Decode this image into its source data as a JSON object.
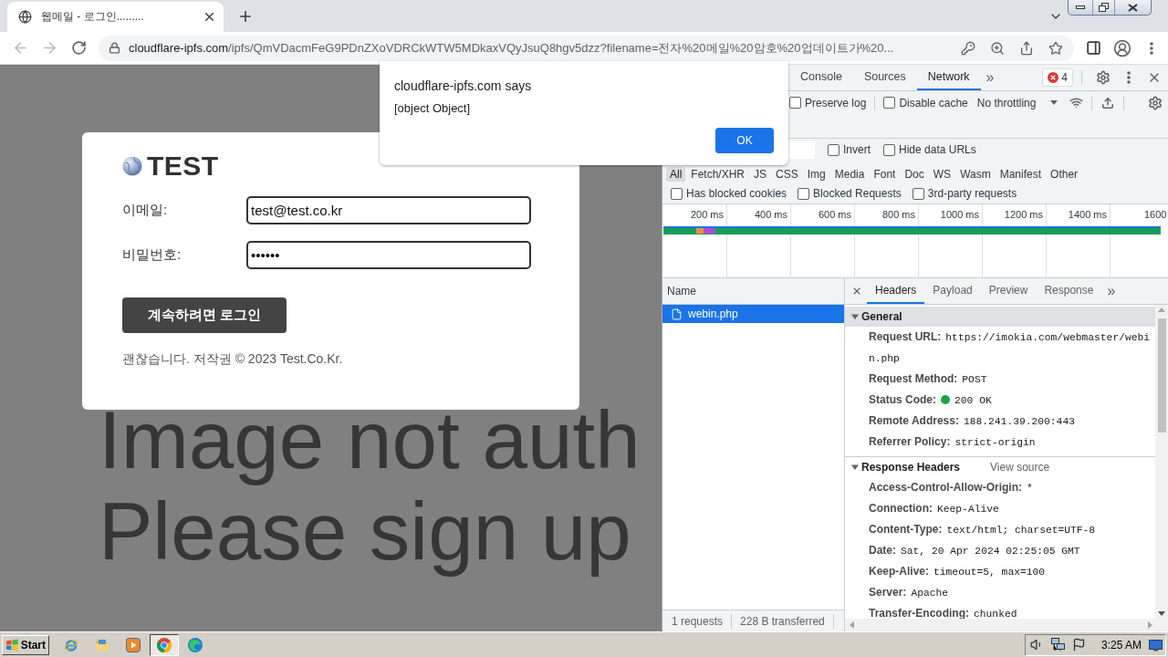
{
  "browser": {
    "tabs": [
      {
        "title": "웹메일 - 로그인.........",
        "selected": true
      }
    ],
    "address": {
      "host": "cloudflare-ipfs.com",
      "path": "/ipfs/QmVDacmFeG9PDnZXoVDRCkWTW5MDkaxVQyJsuQ8hgv5dzz?filename=전자%20메일%20암호%20업데이트가%20..."
    }
  },
  "page": {
    "logo": "TEST",
    "fields": [
      {
        "label": "이메일:",
        "value": "test@test.co.kr"
      },
      {
        "label": "비밀번호:",
        "value": "••••••"
      }
    ],
    "button": "계속하려면 로그인",
    "footer": "괜찮습니다. 저작권 © 2023 Test.Co.Kr.",
    "background_text": [
      "Image not auth",
      "Please sign up"
    ]
  },
  "dialog": {
    "title": "cloudflare-ipfs.com says",
    "message": "[object Object]",
    "button": "OK"
  },
  "devtools": {
    "tabs": [
      {
        "label": "Console",
        "selected": false
      },
      {
        "label": "Sources",
        "selected": false
      },
      {
        "label": "Network",
        "selected": true
      }
    ],
    "more_tabs": "»",
    "error_count": "4",
    "toolbar_checks": [
      {
        "label": "Preserve log",
        "checked": false
      },
      {
        "label": "Disable cache",
        "checked": false
      }
    ],
    "throttling": "No throttling",
    "filter_checks": [
      {
        "label": "Invert",
        "checked": false
      },
      {
        "label": "Hide data URLs",
        "checked": false
      }
    ],
    "type_filters": [
      {
        "label": "All",
        "selected": true
      },
      {
        "label": "Fetch/XHR",
        "selected": false
      },
      {
        "label": "JS",
        "selected": false
      },
      {
        "label": "CSS",
        "selected": false
      },
      {
        "label": "Img",
        "selected": false
      },
      {
        "label": "Media",
        "selected": false
      },
      {
        "label": "Font",
        "selected": false
      },
      {
        "label": "Doc",
        "selected": false
      },
      {
        "label": "WS",
        "selected": false
      },
      {
        "label": "Wasm",
        "selected": false
      },
      {
        "label": "Manifest",
        "selected": false
      },
      {
        "label": "Other",
        "selected": false
      }
    ],
    "request_checks": [
      {
        "label": "Has blocked cookies",
        "checked": false
      },
      {
        "label": "Blocked Requests",
        "checked": false
      },
      {
        "label": "3rd-party requests",
        "checked": false
      }
    ],
    "overview_ticks": [
      "200 ms",
      "400 ms",
      "600 ms",
      "800 ms",
      "1000 ms",
      "1200 ms",
      "1400 ms",
      "1600"
    ],
    "requests": {
      "column": "Name",
      "rows": [
        {
          "name": "webin.php",
          "selected": true
        }
      ]
    },
    "summary": [
      "1 requests",
      "228 B transferred"
    ],
    "detail_tabs": [
      {
        "label": "Headers",
        "selected": true
      },
      {
        "label": "Payload",
        "selected": false
      },
      {
        "label": "Preview",
        "selected": false
      },
      {
        "label": "Response",
        "selected": false
      }
    ],
    "more_detail_tabs": "»",
    "sections": [
      {
        "title": "General",
        "expanded": true,
        "highlighted": true,
        "rows": [
          {
            "name": "Request URL:",
            "value": "https://imokia.com/webmaster/webin.php",
            "kind": "plain"
          },
          {
            "name": "Request Method:",
            "value": "POST",
            "kind": "plain"
          },
          {
            "name": "Status Code:",
            "value": "200 OK",
            "kind": "status"
          },
          {
            "name": "Remote Address:",
            "value": "188.241.39.200:443",
            "kind": "plain"
          },
          {
            "name": "Referrer Policy:",
            "value": "strict-origin",
            "kind": "plain"
          }
        ]
      },
      {
        "title": "Response Headers",
        "expanded": true,
        "highlighted": false,
        "link": "View source",
        "rows": [
          {
            "name": "Access-Control-Allow-Origin:",
            "value": "*",
            "kind": "plain"
          },
          {
            "name": "Connection:",
            "value": "Keep-Alive",
            "kind": "plain"
          },
          {
            "name": "Content-Type:",
            "value": "text/html; charset=UTF-8",
            "kind": "plain"
          },
          {
            "name": "Date:",
            "value": "Sat, 20 Apr 2024 02:25:05 GMT",
            "kind": "plain"
          },
          {
            "name": "Keep-Alive:",
            "value": "timeout=5, max=100",
            "kind": "plain"
          },
          {
            "name": "Server:",
            "value": "Apache",
            "kind": "plain"
          },
          {
            "name": "Transfer-Encoding:",
            "value": "chunked",
            "kind": "plain"
          }
        ]
      }
    ]
  },
  "taskbar": {
    "start": "Start",
    "apps": [
      {
        "kind": "ie",
        "active": false
      },
      {
        "kind": "folder",
        "active": false
      },
      {
        "kind": "media",
        "active": false
      },
      {
        "kind": "chrome",
        "active": true
      },
      {
        "kind": "edge",
        "active": false
      }
    ],
    "time": "3:25 AM"
  }
}
